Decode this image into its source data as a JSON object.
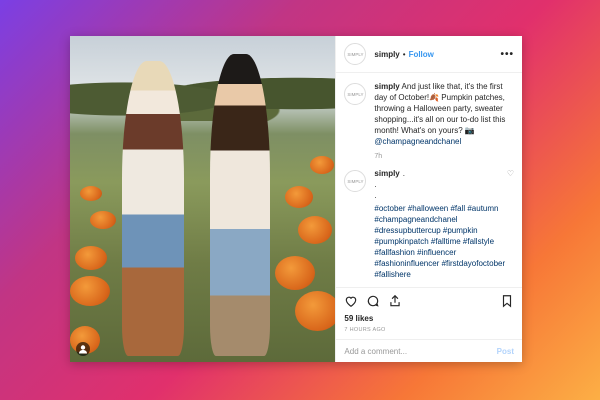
{
  "post": {
    "username": "simply",
    "avatar_text": "SIMPLY",
    "follow_label": "Follow",
    "more_label": "•••",
    "caption_username": "simply",
    "caption_text": "And just like that, it's the first day of October!🍂 Pumpkin patches, throwing a Halloween party, sweater shopping...it's all on our to-do list this month! What's on yours? 📷",
    "caption_mention": "@champagneandchanel",
    "caption_time": "7h",
    "comment_username": "simply",
    "comment_dots": [
      ".",
      ".",
      "."
    ],
    "hashtags": "#october #halloween #fall #autumn #champagneandchanel #dressupbuttercup #pumpkin #pumpkinpatch #falltime #fallstyle #fallfashion #influencer #fashioninfluencer #firstdayofoctober #fallishere",
    "likes": "59 likes",
    "time_ago": "7 HOURS AGO",
    "add_comment_placeholder": "Add a comment...",
    "post_label": "Post"
  },
  "icons": {
    "like": "heart-icon",
    "comment": "comment-icon",
    "share": "share-icon",
    "save": "bookmark-icon",
    "tagged_user": "user-icon"
  },
  "colors": {
    "link": "#3897f0",
    "text": "#262626",
    "muted": "#999999"
  }
}
